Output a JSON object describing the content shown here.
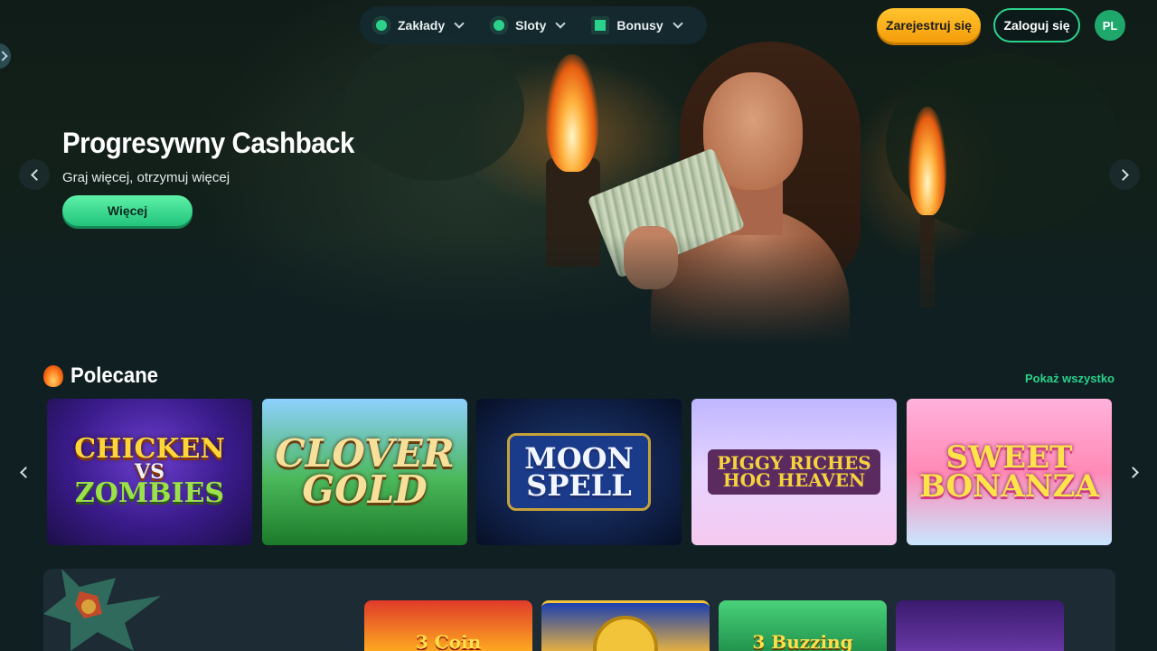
{
  "nav": {
    "items": [
      {
        "label": "Zakłady",
        "icon": "football-icon"
      },
      {
        "label": "Sloty",
        "icon": "slots-icon"
      },
      {
        "label": "Bonusy",
        "icon": "gift-cube-icon"
      }
    ]
  },
  "header": {
    "register_label": "Zarejestruj się",
    "login_label": "Zaloguj się",
    "language": "PL"
  },
  "hero": {
    "title": "Progresywny Cashback",
    "subtitle": "Graj więcej, otrzymuj więcej",
    "button_label": "Więcej"
  },
  "featured": {
    "title": "Polecane",
    "show_all": "Pokaż wszystko",
    "games": [
      {
        "line1": "Chicken",
        "line2": "vs",
        "line3": "Zombies"
      },
      {
        "line1": "Clover",
        "line2": "Gold"
      },
      {
        "line1": "Moon",
        "line2": "Spell"
      },
      {
        "line1": "Piggy Riches",
        "line2": "Hog Heaven"
      },
      {
        "line1": "Sweet",
        "line2": "Bonanza"
      }
    ]
  },
  "promo": {
    "games": [
      {
        "label": "3 Coin"
      },
      {
        "label": ""
      },
      {
        "label": "3 Buzzing"
      },
      {
        "label": ""
      }
    ]
  },
  "colors": {
    "accent_green": "#2bd28c",
    "register_orange": "#f59d0b",
    "background": "#0f1f22"
  }
}
